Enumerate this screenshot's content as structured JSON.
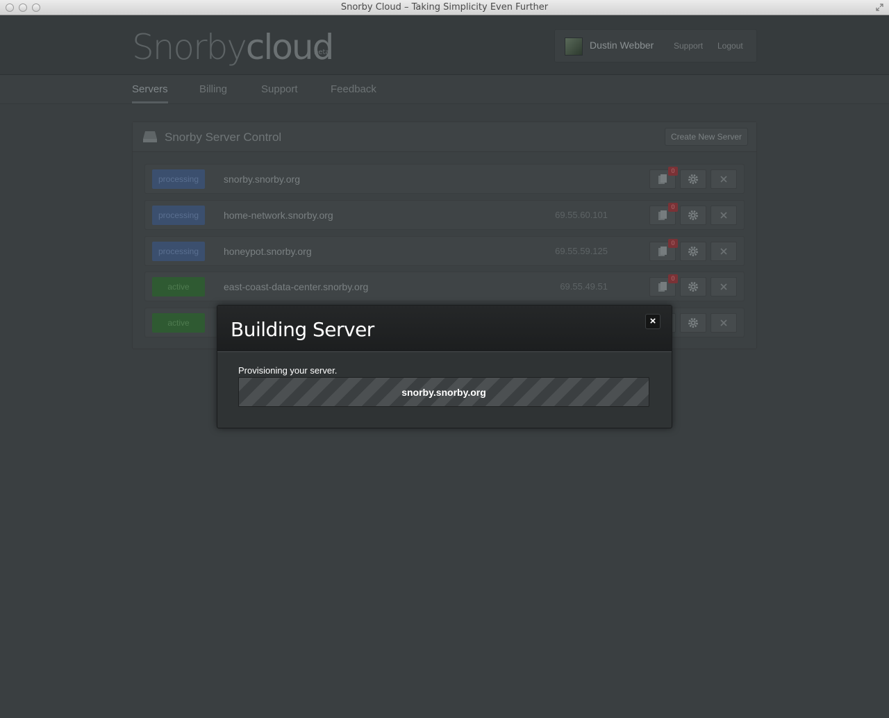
{
  "window": {
    "title": "Snorby Cloud – Taking Simplicity Even Further"
  },
  "header": {
    "logo_snorby": "Snorby",
    "logo_cloud": "cloud",
    "logo_beta": "beta",
    "user_name": "Dustin Webber",
    "support_link": "Support",
    "logout_link": "Logout"
  },
  "nav": {
    "items": [
      {
        "label": "Servers",
        "active": true
      },
      {
        "label": "Billing",
        "active": false
      },
      {
        "label": "Support",
        "active": false
      },
      {
        "label": "Feedback",
        "active": false
      }
    ]
  },
  "panel": {
    "title": "Snorby Server Control",
    "create_button": "Create New Server",
    "servers": [
      {
        "status": "processing",
        "host": "snorby.snorby.org",
        "ip": "",
        "alerts": "0"
      },
      {
        "status": "processing",
        "host": "home-network.snorby.org",
        "ip": "69.55.60.101",
        "alerts": "0"
      },
      {
        "status": "processing",
        "host": "honeypot.snorby.org",
        "ip": "69.55.59.125",
        "alerts": "0"
      },
      {
        "status": "active",
        "host": "east-coast-data-center.snorby.org",
        "ip": "69.55.49.51",
        "alerts": "0"
      },
      {
        "status": "active",
        "host": "",
        "ip": "",
        "alerts": ""
      }
    ]
  },
  "modal": {
    "title": "Building Server",
    "close_label": "×",
    "status_text": "Provisioning your server.",
    "progress_label": "snorby.snorby.org"
  },
  "colors": {
    "background": "#3a3f41",
    "processing": "#3b4f6e",
    "active": "#2f5a32",
    "alert_badge": "#7a3236"
  }
}
